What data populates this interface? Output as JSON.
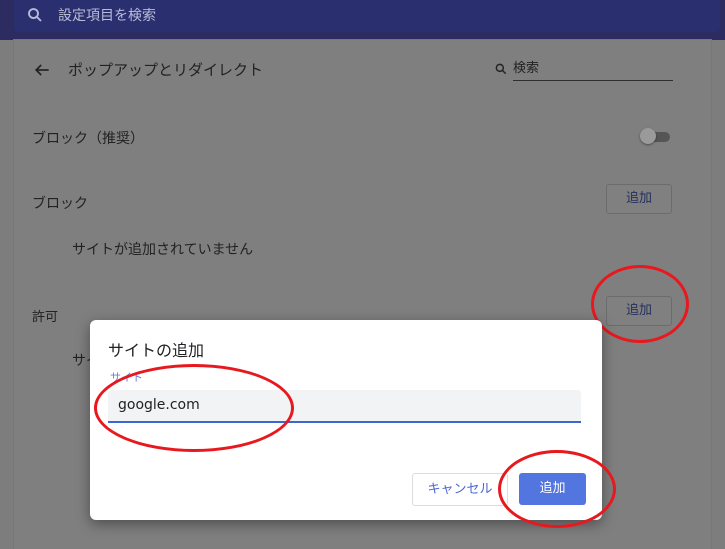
{
  "topbar": {
    "search_placeholder": "設定項目を検索",
    "search_icon": "search-icon"
  },
  "header": {
    "title": "ポップアップとリダイレクト",
    "back_icon": "arrow-back-icon",
    "search_value": "検索"
  },
  "block_toggle": {
    "label": "ブロック（推奨）",
    "enabled": false
  },
  "block_section": {
    "label": "ブロック",
    "add_label": "追加",
    "empty_text": "サイトが追加されていません"
  },
  "allow_section": {
    "label": "許可",
    "add_label": "追加",
    "partial_text": "サイ"
  },
  "dialog": {
    "title": "サイトの追加",
    "field_label": "サイト",
    "input_value": "google.com",
    "cancel_label": "キャンセル",
    "add_label": "追加"
  },
  "colors": {
    "accent": "#5275e0",
    "annotation": "#e8181f",
    "topbar": "#2c2c61"
  }
}
